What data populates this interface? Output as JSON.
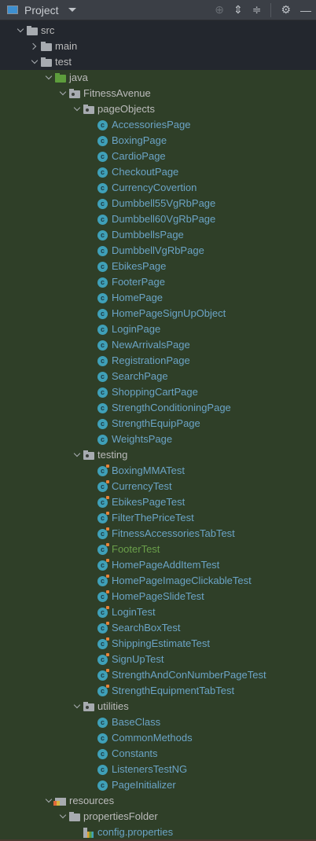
{
  "header": {
    "title": "Project",
    "icons": [
      "locate-icon",
      "expand-all-icon",
      "collapse-all-icon",
      "gear-icon",
      "minimize-icon"
    ]
  },
  "colors": {
    "tree_bg": "#23272e",
    "test_bg": "#2f3f28",
    "class_text": "#6ba4c6",
    "modified_text": "#6a9f4a"
  },
  "tree": [
    {
      "label": "src",
      "type": "folder",
      "open": true,
      "children": [
        {
          "label": "main",
          "type": "folder",
          "open": false
        },
        {
          "label": "test",
          "type": "folder",
          "open": true,
          "children": [
            {
              "label": "java",
              "type": "source-folder",
              "open": true,
              "children": [
                {
                  "label": "FitnessAvenue",
                  "type": "package",
                  "open": true,
                  "children": [
                    {
                      "label": "pageObjects",
                      "type": "package",
                      "open": true,
                      "children": [
                        {
                          "label": "AccessoriesPage",
                          "type": "class"
                        },
                        {
                          "label": "BoxingPage",
                          "type": "class"
                        },
                        {
                          "label": "CardioPage",
                          "type": "class"
                        },
                        {
                          "label": "CheckoutPage",
                          "type": "class"
                        },
                        {
                          "label": "CurrencyCovertion",
                          "type": "class"
                        },
                        {
                          "label": "Dumbbell55VgRbPage",
                          "type": "class"
                        },
                        {
                          "label": "Dumbbell60VgRbPage",
                          "type": "class"
                        },
                        {
                          "label": "DumbbellsPage",
                          "type": "class"
                        },
                        {
                          "label": "DumbbellVgRbPage",
                          "type": "class"
                        },
                        {
                          "label": "EbikesPage",
                          "type": "class"
                        },
                        {
                          "label": "FooterPage",
                          "type": "class"
                        },
                        {
                          "label": "HomePage",
                          "type": "class"
                        },
                        {
                          "label": "HomePageSignUpObject",
                          "type": "class"
                        },
                        {
                          "label": "LoginPage",
                          "type": "class"
                        },
                        {
                          "label": "NewArrivalsPage",
                          "type": "class"
                        },
                        {
                          "label": "RegistrationPage",
                          "type": "class"
                        },
                        {
                          "label": "SearchPage",
                          "type": "class"
                        },
                        {
                          "label": "ShoppingCartPage",
                          "type": "class"
                        },
                        {
                          "label": "StrengthConditioningPage",
                          "type": "class"
                        },
                        {
                          "label": "StrengthEquipPage",
                          "type": "class"
                        },
                        {
                          "label": "WeightsPage",
                          "type": "class"
                        }
                      ]
                    },
                    {
                      "label": "testing",
                      "type": "package",
                      "open": true,
                      "children": [
                        {
                          "label": "BoxingMMATest",
                          "type": "test-class"
                        },
                        {
                          "label": "CurrencyTest",
                          "type": "test-class"
                        },
                        {
                          "label": "EbikesPageTest",
                          "type": "test-class"
                        },
                        {
                          "label": "FilterThePriceTest",
                          "type": "test-class"
                        },
                        {
                          "label": "FitnessAccessoriesTabTest",
                          "type": "test-class"
                        },
                        {
                          "label": "FooterTest",
                          "type": "test-class",
                          "status": "modified"
                        },
                        {
                          "label": "HomePageAddItemTest",
                          "type": "test-class"
                        },
                        {
                          "label": "HomePageImageClickableTest",
                          "type": "test-class"
                        },
                        {
                          "label": "HomePageSlideTest",
                          "type": "test-class"
                        },
                        {
                          "label": "LoginTest",
                          "type": "test-class"
                        },
                        {
                          "label": "SearchBoxTest",
                          "type": "test-class"
                        },
                        {
                          "label": "ShippingEstimateTest",
                          "type": "test-class"
                        },
                        {
                          "label": "SignUpTest",
                          "type": "test-class"
                        },
                        {
                          "label": "StrengthAndConNumberPageTest",
                          "type": "test-class"
                        },
                        {
                          "label": "StrengthEquipmentTabTest",
                          "type": "test-class"
                        }
                      ]
                    },
                    {
                      "label": "utilities",
                      "type": "package",
                      "open": true,
                      "children": [
                        {
                          "label": "BaseClass",
                          "type": "class"
                        },
                        {
                          "label": "CommonMethods",
                          "type": "class"
                        },
                        {
                          "label": "Constants",
                          "type": "class"
                        },
                        {
                          "label": "ListenersTestNG",
                          "type": "class"
                        },
                        {
                          "label": "PageInitializer",
                          "type": "class"
                        }
                      ]
                    }
                  ]
                }
              ]
            },
            {
              "label": "resources",
              "type": "resources-folder",
              "open": true,
              "children": [
                {
                  "label": "propertiesFolder",
                  "type": "folder",
                  "open": true,
                  "children": [
                    {
                      "label": "config.properties",
                      "type": "properties-file"
                    }
                  ]
                }
              ]
            }
          ]
        }
      ]
    }
  ]
}
